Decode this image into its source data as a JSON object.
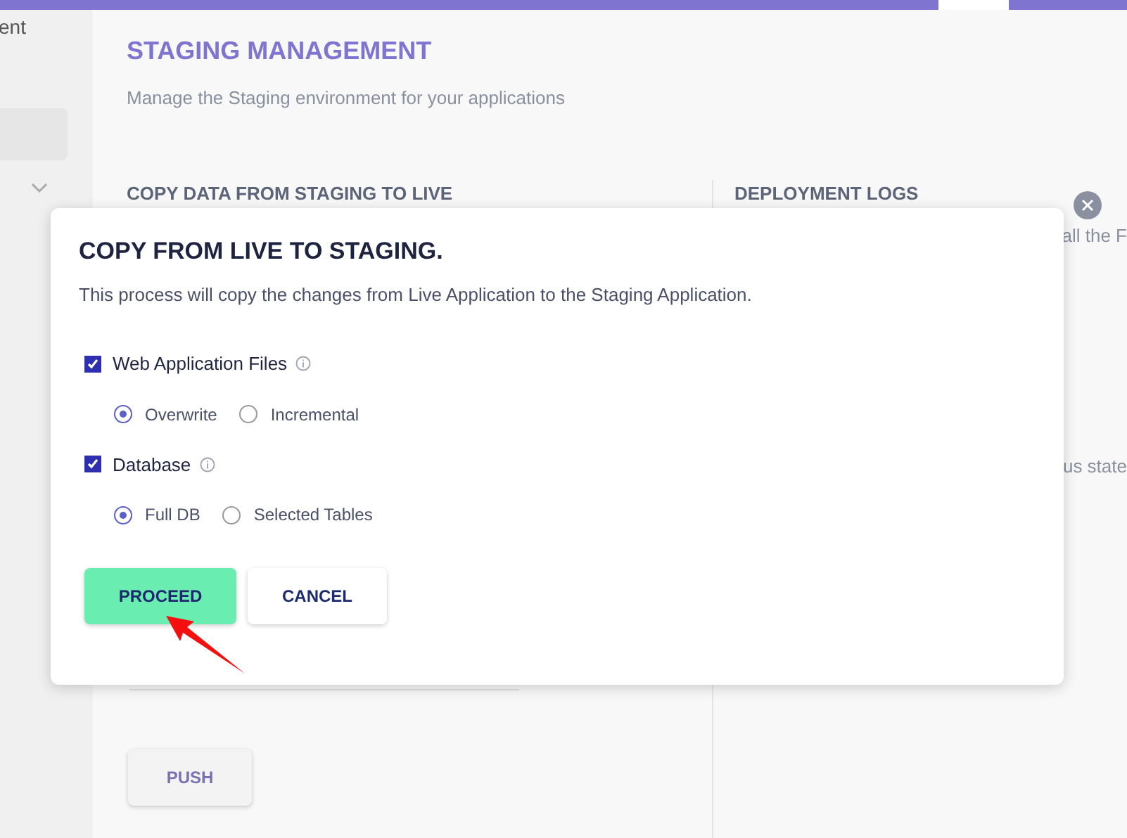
{
  "sidebar": {
    "title_fragment": "ent"
  },
  "page": {
    "title": "STAGING MANAGEMENT",
    "subtitle": "Manage the Staging environment for your applications",
    "left_section": {
      "title": "COPY DATA FROM STAGING TO LIVE",
      "button": "PUSH"
    },
    "right_section": {
      "title": "DEPLOYMENT LOGS",
      "text_fragments": [
        "all the F",
        "us state"
      ]
    }
  },
  "modal": {
    "title": "COPY FROM LIVE TO STAGING.",
    "description": "This process will copy the changes from Live Application to the Staging Application.",
    "options": [
      {
        "label": "Web Application Files",
        "checked": true,
        "choices": [
          {
            "label": "Overwrite",
            "selected": true
          },
          {
            "label": "Incremental",
            "selected": false
          }
        ]
      },
      {
        "label": "Database",
        "checked": true,
        "choices": [
          {
            "label": "Full DB",
            "selected": true
          },
          {
            "label": "Selected Tables",
            "selected": false
          }
        ]
      }
    ],
    "buttons": [
      {
        "label": "PROCEED",
        "kind": "primary"
      },
      {
        "label": "CANCEL",
        "kind": "secondary"
      }
    ]
  }
}
